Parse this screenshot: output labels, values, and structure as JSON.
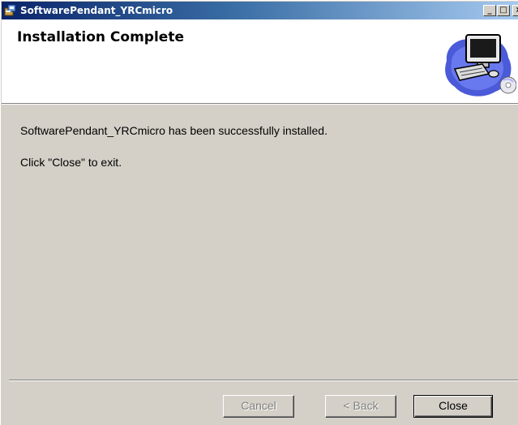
{
  "window": {
    "title": "SoftwarePendant_YRCmicro",
    "controls": {
      "minimize": "_",
      "maximize": "□",
      "close": "×"
    }
  },
  "header": {
    "title": "Installation Complete",
    "icon": "computer-setup-icon"
  },
  "body": {
    "message": "SoftwarePendant_YRCmicro has been successfully installed.",
    "instruction": "Click \"Close\" to exit."
  },
  "buttons": {
    "cancel": "Cancel",
    "back": "< Back",
    "close": "Close"
  },
  "colors": {
    "titlebar_start": "#0a246a",
    "titlebar_end": "#a6caf0",
    "dialog_background": "#d4d0c8",
    "header_background": "#ffffff"
  }
}
